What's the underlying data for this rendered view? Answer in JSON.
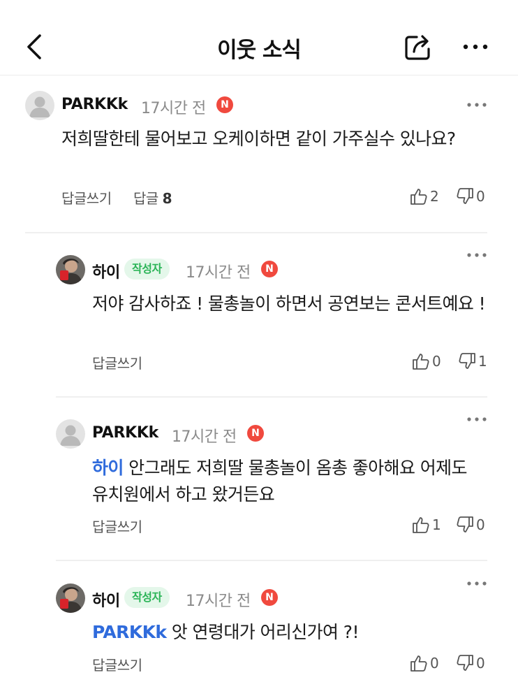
{
  "header": {
    "title": "이웃 소식",
    "back_icon": "chevron-left-icon",
    "share_icon": "share-icon",
    "more_icon": "more-horizontal-icon"
  },
  "comments": [
    {
      "author": "PARKKk",
      "time": "17시간 전",
      "new_badge": "N",
      "text": "저희딸한테 물어보고 오케이하면 같이 가주실수 있나요?",
      "reply_label": "답글쓰기",
      "replies_label": "답글",
      "replies_count": "8",
      "likes": "2",
      "dislikes": "0"
    },
    {
      "author": "하이",
      "author_badge": "작성자",
      "time": "17시간 전",
      "new_badge": "N",
      "text": "저야 감사하죠 ! 물총놀이 하면서 공연보는 콘서트예요 !",
      "reply_label": "답글쓰기",
      "likes": "0",
      "dislikes": "1"
    },
    {
      "author": "PARKKk",
      "time": "17시간 전",
      "new_badge": "N",
      "mention": "하이",
      "text": "안그래도 저희딸 물총놀이 옴총 좋아해요 어제도 유치원에서 하고 왔거든요",
      "reply_label": "답글쓰기",
      "likes": "1",
      "dislikes": "0"
    },
    {
      "author": "하이",
      "author_badge": "작성자",
      "time": "17시간 전",
      "new_badge": "N",
      "mention": "PARKKk",
      "text": "앗 연령대가 어리신가여 ?!",
      "reply_label": "답글쓰기",
      "likes": "0",
      "dislikes": "0"
    }
  ],
  "colors": {
    "mention": "#2f6bdc",
    "new_badge": "#f0493e",
    "author_badge_bg": "#e4f7ea",
    "author_badge_text": "#2bb457"
  }
}
